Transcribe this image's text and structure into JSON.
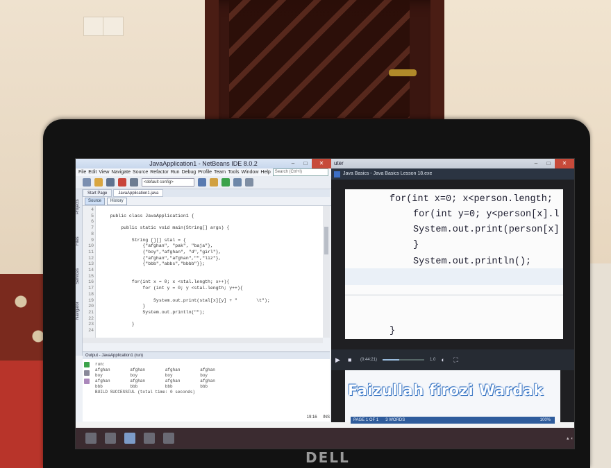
{
  "netbeans": {
    "window_title": "JavaApplication1 - NetBeans IDE 8.0.2",
    "menu": [
      "File",
      "Edit",
      "View",
      "Navigate",
      "Source",
      "Refactor",
      "Run",
      "Debug",
      "Profile",
      "Team",
      "Tools",
      "Window",
      "Help"
    ],
    "search_placeholder": "Search (Ctrl+I)",
    "config_select": "<default config>",
    "side_tabs": [
      "Projects",
      "Files",
      "Services",
      "Navigator"
    ],
    "editor_tabs": [
      "Start Page",
      "JavaApplication1.java"
    ],
    "editor_modes": [
      "Source",
      "History"
    ],
    "code_lines": [
      {
        "n": "4",
        "t": ""
      },
      {
        "n": "5",
        "t": "    public class JavaApplication1 {"
      },
      {
        "n": "6",
        "t": ""
      },
      {
        "n": "7",
        "t": "        public static void main(String[] args) {"
      },
      {
        "n": "8",
        "t": ""
      },
      {
        "n": "9",
        "t": "            String [][] stal = {"
      },
      {
        "n": "10",
        "t": "                {\"afghan\", \"pak\", \"baja\"},"
      },
      {
        "n": "11",
        "t": "                {\"boy\",\"afghan\", \"d\",\"girl\"},"
      },
      {
        "n": "12",
        "t": "                {\"afghan\",\"afghan\",\"\",\"liz\"},"
      },
      {
        "n": "13",
        "t": "                {\"bbb\",\"abbs\",\"bbbb\"}};"
      },
      {
        "n": "14",
        "t": ""
      },
      {
        "n": "15",
        "t": ""
      },
      {
        "n": "16",
        "t": "            for(int x = 0; x <stal.length; x++){"
      },
      {
        "n": "17",
        "t": "                for (int y = 0; y <stal.length; y++){"
      },
      {
        "n": "18",
        "t": ""
      },
      {
        "n": "19",
        "t": "                    System.out.print(stal[x][y] + \"       \\t\");"
      },
      {
        "n": "20",
        "t": "                }"
      },
      {
        "n": "21",
        "t": "                System.out.println(\"\");"
      },
      {
        "n": "22",
        "t": ""
      },
      {
        "n": "23",
        "t": "            }"
      },
      {
        "n": "24",
        "t": ""
      }
    ],
    "output_title": "Output - JavaApplication1 (run)",
    "output_lines": [
      "run:",
      "afghan        afghan        afghan        afghan",
      "boy           boy           boy           boy",
      "afghan        afghan        afghan        afghan",
      "bbb           bbb           bbb           bbb",
      "BUILD SUCCESSFUL (total time: 0 seconds)"
    ],
    "status_position": "19:16",
    "status_ins": "INS"
  },
  "player": {
    "window_title": "uter",
    "video_title": "Java Basics - Java Basics Lesson 18.exe",
    "video_lines": [
      {
        "text": "for(int x=0; x<person.length;"
      },
      {
        "text": "for(int y=0; y<person[x].l"
      },
      {
        "text": "System.out.print(person[x]"
      },
      {
        "text": "}"
      },
      {
        "text": "System.out.println();"
      },
      {
        "text": "}"
      },
      {
        "text": "}"
      }
    ],
    "time_current": "(0:44:21)",
    "speed": "1.0",
    "watermark": "Faizullah firozi Wardak",
    "word_status": [
      "PAGE 1 OF 1",
      "3 WORDS"
    ],
    "zoom": "100%"
  },
  "laptop_brand": "DELL",
  "colors": {
    "keyword": "#1a1a44",
    "italic_member": "#3e58a8",
    "watermark_outline": "#2d6bb8",
    "taskbar": "#3b2b30"
  }
}
